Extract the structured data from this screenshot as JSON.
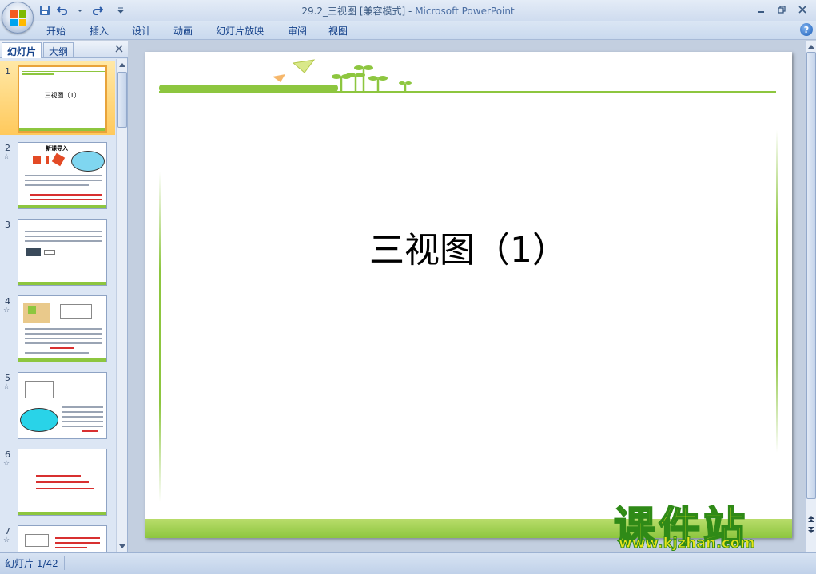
{
  "window": {
    "title": "29.2_三视图 [兼容模式]",
    "app_name": "Microsoft PowerPoint",
    "title_separator": " - "
  },
  "ribbon": {
    "tabs": [
      "开始",
      "插入",
      "设计",
      "动画",
      "幻灯片放映",
      "审阅",
      "视图"
    ]
  },
  "left_pane": {
    "tabs": [
      "幻灯片",
      "大纲"
    ],
    "active_tab": "幻灯片",
    "slides": [
      {
        "number": "1",
        "title": "三视图（1）",
        "has_animation": false
      },
      {
        "number": "2",
        "title": "新课导入",
        "has_animation": true
      },
      {
        "number": "3",
        "title": "",
        "has_animation": false
      },
      {
        "number": "4",
        "title": "",
        "has_animation": true
      },
      {
        "number": "5",
        "title": "",
        "has_animation": true
      },
      {
        "number": "6",
        "title": "",
        "has_animation": true
      },
      {
        "number": "7",
        "title": "",
        "has_animation": true
      }
    ],
    "animation_glyph": "☆"
  },
  "slide": {
    "title": "三视图（1）",
    "accent_color": "#8dc63f"
  },
  "status": {
    "slide_indicator": "幻灯片 1/42"
  },
  "watermark": {
    "brand": "课件站",
    "url": "www.kjzhan.com"
  },
  "icons": {
    "office_button": "office-logo-icon",
    "save": "save-icon",
    "undo": "undo-icon",
    "redo": "redo-icon",
    "help": "help-icon",
    "close_pane": "close-icon"
  }
}
